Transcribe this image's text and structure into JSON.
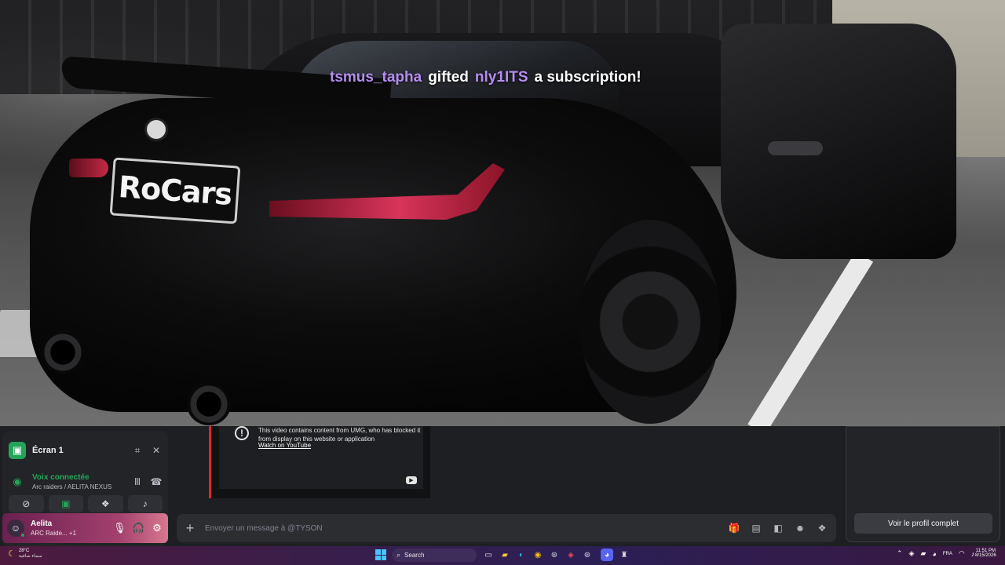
{
  "video": {
    "plate_text": "RoCars",
    "sub_alert": {
      "gifter": "tsmus_tapha",
      "action": "gifted",
      "recipient": "nly1ITS",
      "suffix": "a subscription!",
      "name_color": "#b68cf0"
    }
  },
  "discord": {
    "stream": {
      "label": "Écran 1",
      "icon": "screen-share-icon"
    },
    "voice": {
      "title": "Voix connectée",
      "subtitle": "Arc raiders / AELITA NEXUS",
      "color": "#23a559"
    },
    "user": {
      "name": "Aelita",
      "status": "ARC Raide... +1"
    },
    "embed": {
      "warning": "This video contains content from UMG, who has blocked it from display on this website or application",
      "link": "Watch on YouTube"
    },
    "message_placeholder": "Envoyer un message à @TYSON",
    "profile_button": "Voir le profil complet",
    "accent": "#23a559"
  },
  "taskbar": {
    "weather_temp": "28°C",
    "weather_desc": "سماء صافية",
    "search_label": "Search",
    "language": "FRA",
    "time": "11:51 PM",
    "date": "8/15/2026"
  }
}
